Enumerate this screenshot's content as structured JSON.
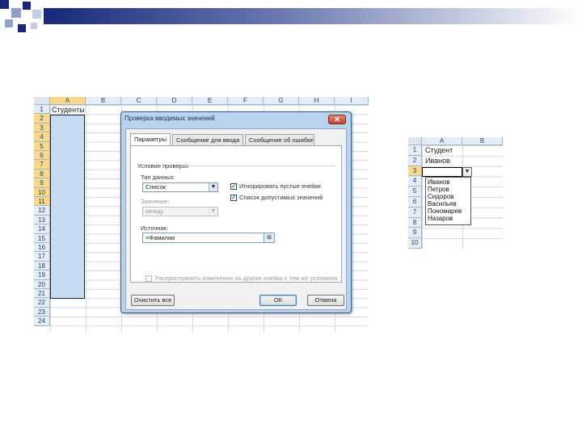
{
  "colors": {
    "accent_blue": "#17287a",
    "deco_gradient_end": "#ffffff",
    "selection_fill": "#c5dcf3",
    "header_fill": "#e4ecf7",
    "header_selected": "#f8d98b",
    "dialog_frame": "#b9d3ee"
  },
  "sheet1": {
    "columns": [
      "A",
      "B",
      "C",
      "D",
      "E",
      "F",
      "G",
      "H",
      "I"
    ],
    "rows": [
      "1",
      "2",
      "3",
      "4",
      "5",
      "6",
      "7",
      "8",
      "9",
      "10",
      "11",
      "12",
      "13",
      "14",
      "15",
      "16",
      "17",
      "18",
      "19",
      "20",
      "21",
      "22",
      "23",
      "24"
    ],
    "a1_value": "Студенты"
  },
  "dialog": {
    "title": "Проверка вводимых значений",
    "close_icon": "close-icon",
    "tabs": [
      "Параметры",
      "Сообщение для ввода",
      "Сообщение об ошибке"
    ],
    "section_title": "Условие проверки",
    "data_type_label": "Тип данных:",
    "data_type_value": "Список",
    "ignore_blank_label": "Игнорировать пустые ячейки",
    "dropdown_label": "Список допустимых значений",
    "value_label": "Значение:",
    "value_value": "между",
    "source_label": "Источник:",
    "source_value": "=Фамилии",
    "apply_all_label": "Распространить изменения на другие ячейки с тем же условием",
    "clear_all_label": "Очистить все",
    "ok_label": "ОК",
    "cancel_label": "Отмена"
  },
  "sheet2": {
    "columns": [
      "A",
      "B"
    ],
    "rows": [
      "1",
      "2",
      "3",
      "4",
      "5",
      "6",
      "7",
      "8",
      "9",
      "10"
    ],
    "a1_value": "Студент",
    "a2_value": "Иванов",
    "dropdown_items": [
      "Иванов",
      "Петров",
      "Сидоров",
      "Васильев",
      "Пономарев",
      "Назаров"
    ]
  }
}
